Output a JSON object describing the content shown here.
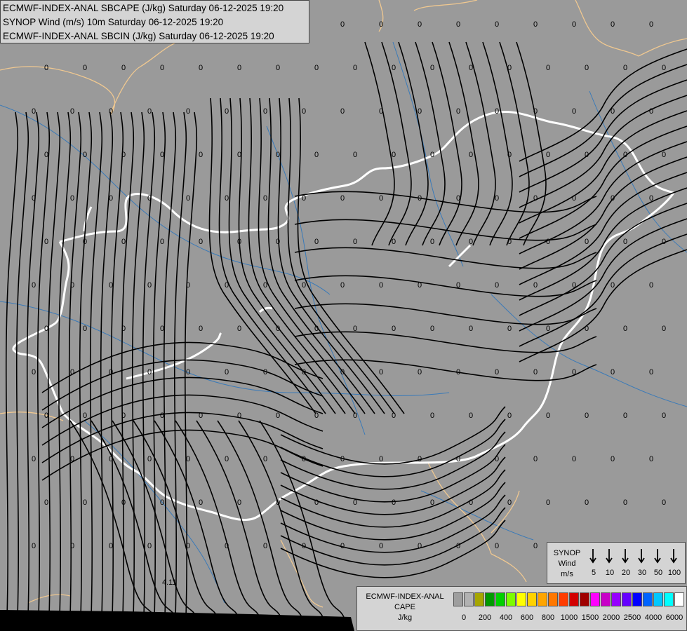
{
  "header": {
    "line1": "ECMWF-INDEX-ANAL SBCAPE (J/kg) Saturday 06-12-2025 19:20",
    "line2": "SYNOP Wind (m/s) 10m Saturday 06-12-2025 19:20",
    "line3": "ECMWF-INDEX-ANAL SBCIN (J/kg) Saturday 06-12-2025 19:20"
  },
  "wind_legend": {
    "title_line1": "SYNOP",
    "title_line2": "Wind",
    "unit": "m/s",
    "speeds": [
      "5",
      "10",
      "20",
      "30",
      "50",
      "100"
    ]
  },
  "cape_legend": {
    "title_line1": "ECMWF-INDEX-ANAL",
    "title_line2": "CAPE",
    "unit": "J/kg",
    "colors": [
      "#9e9e9e",
      "#b2b2b2",
      "#a6a600",
      "#009a00",
      "#00d000",
      "#7cfc00",
      "#ffff00",
      "#ffd200",
      "#ffa500",
      "#ff7800",
      "#ff3c00",
      "#d20000",
      "#a00000",
      "#ff00ff",
      "#c800c8",
      "#9600ff",
      "#6400ff",
      "#0000ff",
      "#0064ff",
      "#00c8ff",
      "#00ffff",
      "#ffffff"
    ],
    "ticks": [
      "0",
      "200",
      "400",
      "600",
      "800",
      "1000",
      "1500",
      "2000",
      "2500",
      "4000",
      "6000"
    ]
  },
  "map": {
    "background_color": "#9a9a9a",
    "country_border_color": "#f0c890",
    "highlight_border_color": "#ffffff",
    "river_color": "#3a7ab8",
    "streamline_color": "#000000",
    "value_label": "0",
    "special_label": "4.11"
  }
}
